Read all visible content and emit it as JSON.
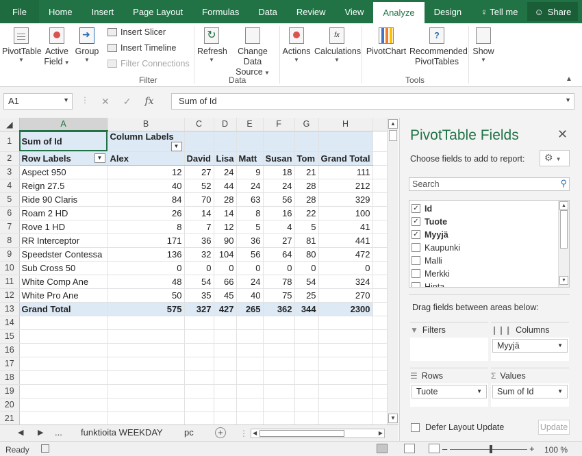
{
  "ribbon_tabs": [
    {
      "label": "File"
    },
    {
      "label": "Home"
    },
    {
      "label": "Insert"
    },
    {
      "label": "Page Layout"
    },
    {
      "label": "Formulas"
    },
    {
      "label": "Data"
    },
    {
      "label": "Review"
    },
    {
      "label": "View"
    },
    {
      "label": "Analyze"
    },
    {
      "label": "Design"
    },
    {
      "label": "♀ Tell me"
    }
  ],
  "share_label": "Share",
  "ribbon": {
    "pivottable": "PivotTable",
    "active_field_1": "Active",
    "active_field_2": "Field",
    "group": "Group",
    "insert_slicer": "Insert Slicer",
    "insert_timeline": "Insert Timeline",
    "filter_connections": "Filter Connections",
    "filter_group": "Filter",
    "refresh": "Refresh",
    "change_ds_1": "Change Data",
    "change_ds_2": "Source",
    "data_group": "Data",
    "actions": "Actions",
    "calculations": "Calculations",
    "pivotchart": "PivotChart",
    "recommended_1": "Recommended",
    "recommended_2": "PivotTables",
    "tools_group": "Tools",
    "show": "Show"
  },
  "formula_bar": {
    "name_box": "A1",
    "formula": "Sum of Id"
  },
  "columns": [
    "A",
    "B",
    "C",
    "D",
    "E",
    "F",
    "G",
    "H"
  ],
  "pivot": {
    "corner_label": "Sum of Id",
    "column_labels": "Column Labels",
    "row_labels": "Row Labels",
    "headers": [
      "Alex",
      "David",
      "Lisa",
      "Matt",
      "Susan",
      "Tom",
      "Grand Total"
    ],
    "rows": [
      {
        "label": "Aspect 950",
        "values": [
          "12",
          "27",
          "24",
          "9",
          "18",
          "21",
          "111"
        ]
      },
      {
        "label": "Reign 27.5",
        "values": [
          "40",
          "52",
          "44",
          "24",
          "24",
          "28",
          "212"
        ]
      },
      {
        "label": "Ride 90 Claris",
        "values": [
          "84",
          "70",
          "28",
          "63",
          "56",
          "28",
          "329"
        ]
      },
      {
        "label": "Roam 2 HD",
        "values": [
          "26",
          "14",
          "14",
          "8",
          "16",
          "22",
          "100"
        ]
      },
      {
        "label": "Rove 1 HD",
        "values": [
          "8",
          "7",
          "12",
          "5",
          "4",
          "5",
          "41"
        ]
      },
      {
        "label": "RR Interceptor",
        "values": [
          "171",
          "36",
          "90",
          "36",
          "27",
          "81",
          "441"
        ]
      },
      {
        "label": "Speedster Contessa",
        "values": [
          "136",
          "32",
          "104",
          "56",
          "64",
          "80",
          "472"
        ]
      },
      {
        "label": "Sub Cross 50",
        "values": [
          "0",
          "0",
          "0",
          "0",
          "0",
          "0",
          "0"
        ]
      },
      {
        "label": "White Comp Ane",
        "values": [
          "48",
          "54",
          "66",
          "24",
          "78",
          "54",
          "324"
        ]
      },
      {
        "label": "White Pro Ane",
        "values": [
          "50",
          "35",
          "45",
          "40",
          "75",
          "25",
          "270"
        ]
      }
    ],
    "grand_total": {
      "label": "Grand Total",
      "values": [
        "575",
        "327",
        "427",
        "265",
        "362",
        "344",
        "2300"
      ]
    }
  },
  "sheet_tabs": {
    "tab1": "funktioita WEEKDAY",
    "tab2": "pc",
    "more": "..."
  },
  "status": {
    "ready": "Ready",
    "zoom": "100 %"
  },
  "pane": {
    "title": "PivotTable Fields",
    "choose": "Choose fields to add to report:",
    "search_placeholder": "Search",
    "fields": [
      {
        "label": "Id",
        "checked": true
      },
      {
        "label": "Tuote",
        "checked": true
      },
      {
        "label": "Myyjä",
        "checked": true
      },
      {
        "label": "Kaupunki",
        "checked": false
      },
      {
        "label": "Malli",
        "checked": false
      },
      {
        "label": "Merkki",
        "checked": false
      },
      {
        "label": "Hinta",
        "checked": false
      }
    ],
    "drag_text": "Drag fields between areas below:",
    "filters_label": "Filters",
    "columns_label": "Columns",
    "columns_value": "Myyjä",
    "rows_label": "Rows",
    "rows_value": "Tuote",
    "values_label": "Values",
    "values_value": "Sum of Id",
    "defer_label": "Defer Layout Update",
    "update_label": "Update"
  },
  "colors": {
    "accent": "#217346",
    "pivot_header": "#dde9f5"
  }
}
